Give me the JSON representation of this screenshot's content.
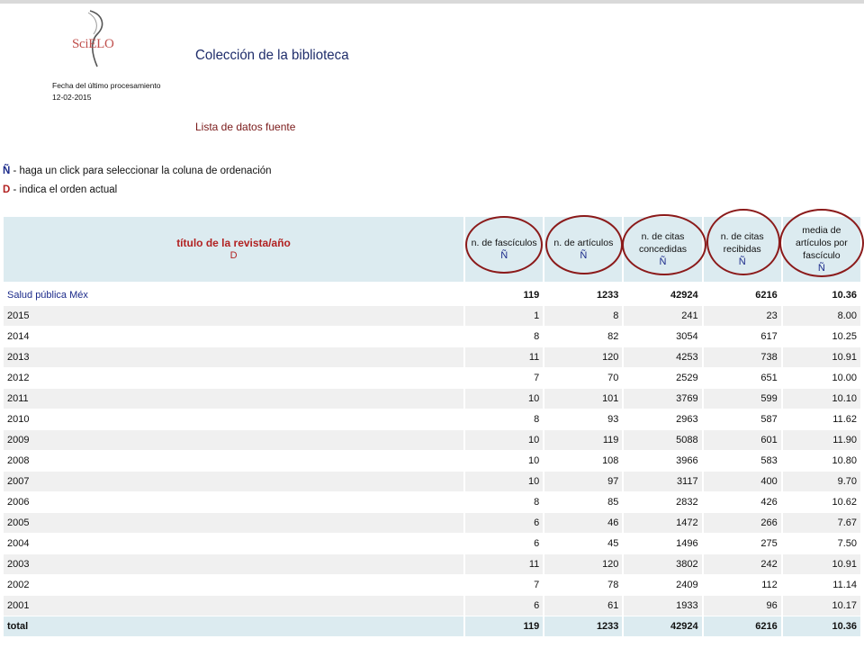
{
  "logo": {
    "text": "SciELO"
  },
  "header": {
    "title": "Colección de la biblioteca",
    "processing_label": "Fecha del último procesamiento",
    "processing_date": "12-02-2015",
    "subtitle": "Lista de datos fuente"
  },
  "legend": {
    "n_symbol": "Ñ",
    "n_text": " - haga un click para seleccionar la coluna de ordenación",
    "d_symbol": "D",
    "d_text": " - indica el orden actual"
  },
  "table": {
    "columns": [
      {
        "label": "título de la revista/año",
        "mark": "D"
      },
      {
        "label": "n. de fascículos",
        "mark": "Ñ"
      },
      {
        "label": "n. de artículos",
        "mark": "Ñ"
      },
      {
        "label": "n. de citas concedidas",
        "mark": "Ñ"
      },
      {
        "label": "n. de citas recibidas",
        "mark": "Ñ"
      },
      {
        "label": "media de artículos por fascículo",
        "mark": "Ñ"
      }
    ],
    "journal": [
      "Salud pública Méx",
      "119",
      "1233",
      "42924",
      "6216",
      "10.36"
    ],
    "rows": [
      [
        "2015",
        "1",
        "8",
        "241",
        "23",
        "8.00"
      ],
      [
        "2014",
        "8",
        "82",
        "3054",
        "617",
        "10.25"
      ],
      [
        "2013",
        "11",
        "120",
        "4253",
        "738",
        "10.91"
      ],
      [
        "2012",
        "7",
        "70",
        "2529",
        "651",
        "10.00"
      ],
      [
        "2011",
        "10",
        "101",
        "3769",
        "599",
        "10.10"
      ],
      [
        "2010",
        "8",
        "93",
        "2963",
        "587",
        "11.62"
      ],
      [
        "2009",
        "10",
        "119",
        "5088",
        "601",
        "11.90"
      ],
      [
        "2008",
        "10",
        "108",
        "3966",
        "583",
        "10.80"
      ],
      [
        "2007",
        "10",
        "97",
        "3117",
        "400",
        "9.70"
      ],
      [
        "2006",
        "8",
        "85",
        "2832",
        "426",
        "10.62"
      ],
      [
        "2005",
        "6",
        "46",
        "1472",
        "266",
        "7.67"
      ],
      [
        "2004",
        "6",
        "45",
        "1496",
        "275",
        "7.50"
      ],
      [
        "2003",
        "11",
        "120",
        "3802",
        "242",
        "10.91"
      ],
      [
        "2002",
        "7",
        "78",
        "2409",
        "112",
        "11.14"
      ],
      [
        "2001",
        "6",
        "61",
        "1933",
        "96",
        "10.17"
      ]
    ],
    "total": [
      "total",
      "119",
      "1233",
      "42924",
      "6216",
      "10.36"
    ]
  },
  "colors": {
    "header_bg": "#dcebf0",
    "title_blue": "#1f2d6b",
    "accent_red": "#b22222",
    "annotation": "#8b1a1a"
  }
}
